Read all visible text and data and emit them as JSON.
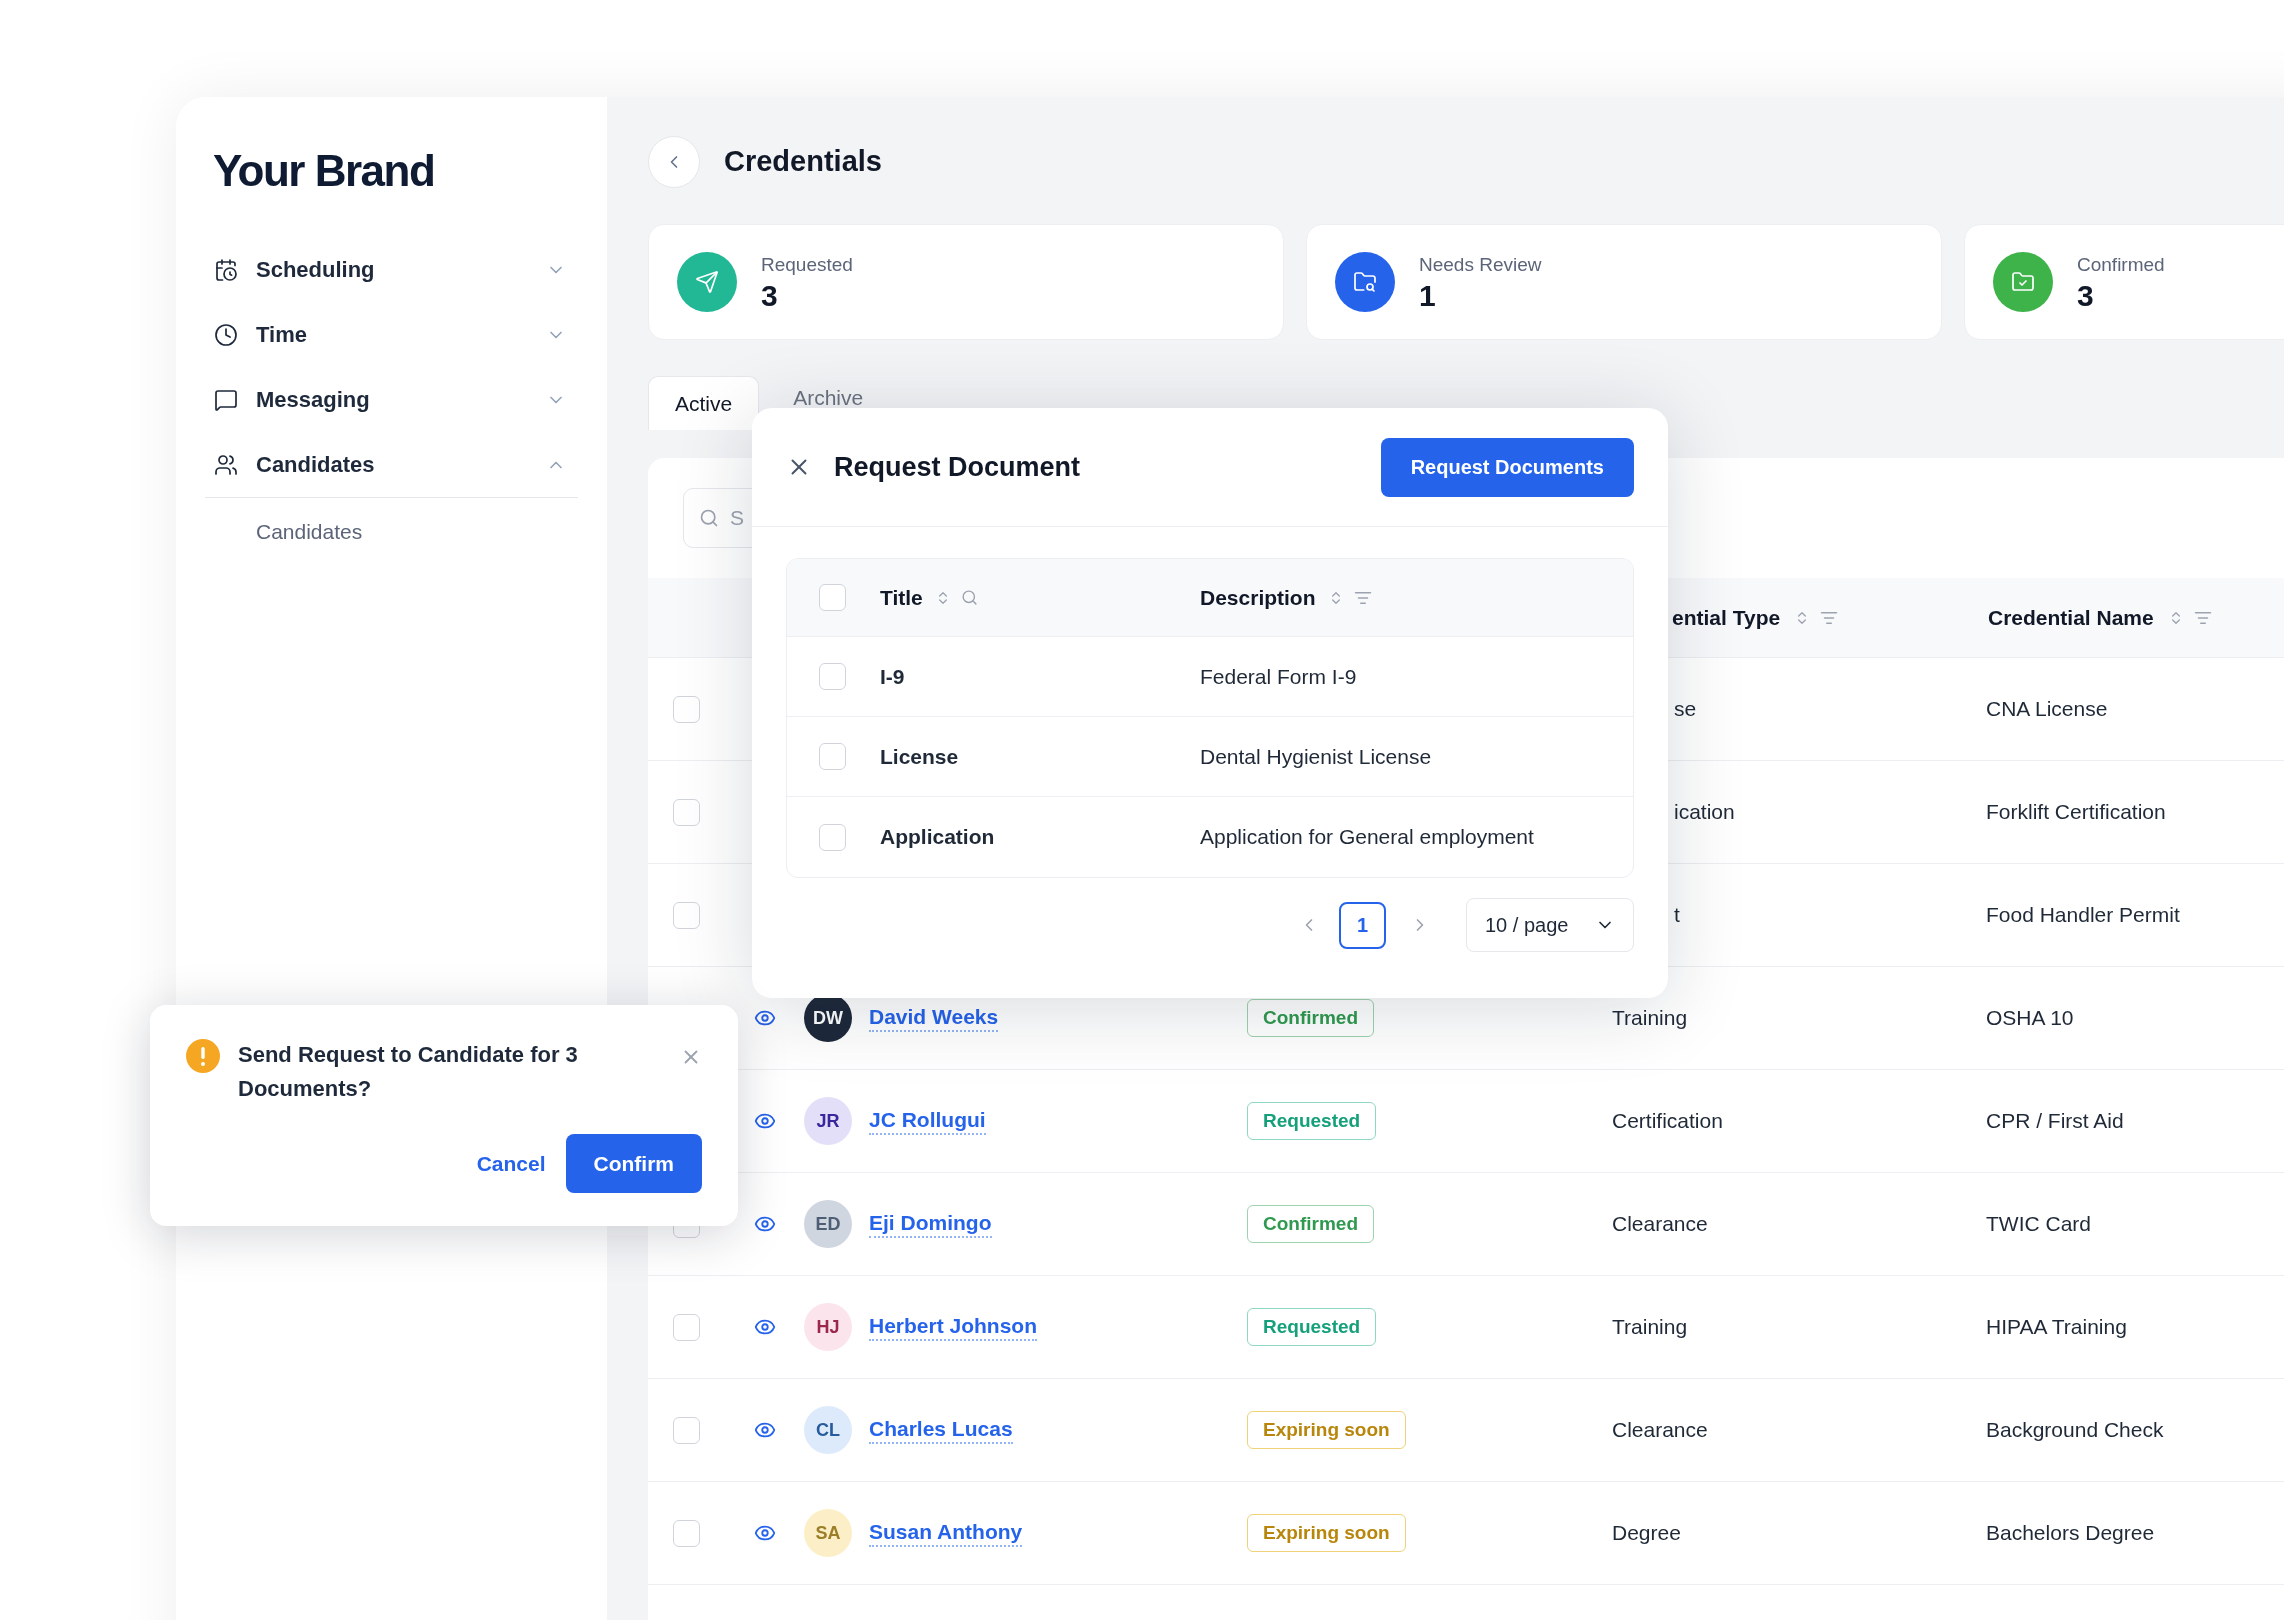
{
  "sidebar": {
    "brand": "Your Brand",
    "items": [
      {
        "label": "Scheduling",
        "expanded": false
      },
      {
        "label": "Time",
        "expanded": false
      },
      {
        "label": "Messaging",
        "expanded": false
      },
      {
        "label": "Candidates",
        "expanded": true,
        "children": [
          {
            "label": "Candidates"
          }
        ]
      }
    ]
  },
  "header": {
    "title": "Credentials"
  },
  "stats": [
    {
      "label": "Requested",
      "value": "3",
      "color": "#22b795"
    },
    {
      "label": "Needs Review",
      "value": "1",
      "color": "#2563eb"
    },
    {
      "label": "Confirmed",
      "value": "3",
      "color": "#3db34a"
    }
  ],
  "tabs": [
    {
      "label": "Active",
      "selected": true
    },
    {
      "label": "Archive",
      "selected": false
    }
  ],
  "table": {
    "search": {
      "placeholder": "S"
    },
    "columns": [
      "ential Type",
      "Credential Name"
    ],
    "rows": [
      {
        "checked": false,
        "type": "se",
        "credential": "CNA License"
      },
      {
        "checked": false,
        "type": "ication",
        "credential": "Forklift Certification"
      },
      {
        "checked": false,
        "type": "t",
        "credential": "Food Handler Permit"
      },
      {
        "initials": "DW",
        "color": "#1e293b",
        "name": "David Weeks",
        "status": {
          "label": "Confirmed",
          "kind": "confirmed"
        },
        "type": "Training",
        "credential": "OSHA 10"
      },
      {
        "initials": "JR",
        "color": "#e3dff8",
        "name": "JC Rollugui",
        "status": {
          "label": "Requested",
          "kind": "requested"
        },
        "type": "Certification",
        "credential": "CPR / First Aid"
      },
      {
        "checked": false,
        "initials": "ED",
        "color": "#cfd6df",
        "name": "Eji Domingo",
        "status": {
          "label": "Confirmed",
          "kind": "confirmed"
        },
        "type": "Clearance",
        "credential": "TWIC Card"
      },
      {
        "checked": false,
        "initials": "HJ",
        "color": "#fce4ec",
        "name": "Herbert Johnson",
        "status": {
          "label": "Requested",
          "kind": "requested"
        },
        "type": "Training",
        "credential": "HIPAA Training"
      },
      {
        "checked": false,
        "initials": "CL",
        "color": "#dceafb",
        "name": "Charles Lucas",
        "status": {
          "label": "Expiring soon",
          "kind": "expiring"
        },
        "type": "Clearance",
        "credential": "Background Check"
      },
      {
        "checked": false,
        "initials": "SA",
        "color": "#fcefc7",
        "name": "Susan Anthony",
        "status": {
          "label": "Expiring soon",
          "kind": "expiring"
        },
        "type": "Degree",
        "credential": "Bachelors Degree"
      }
    ]
  },
  "modal": {
    "title": "Request Document",
    "action": "Request Documents",
    "columns": [
      "Title",
      "Description"
    ],
    "header_checked": false,
    "rows": [
      {
        "title": "I-9",
        "description": "Federal Form I-9",
        "checked": false
      },
      {
        "title": "License",
        "description": "Dental Hygienist License",
        "checked": false
      },
      {
        "title": "Application",
        "description": "Application for General employment",
        "checked": false
      }
    ],
    "pagination": {
      "pages": [
        {
          "label": "1",
          "selected": true
        }
      ],
      "page_size": "10 / page"
    }
  },
  "popconfirm": {
    "message": "Send Request to Candidate for 3 Documents?",
    "cancel": "Cancel",
    "confirm": "Confirm"
  }
}
